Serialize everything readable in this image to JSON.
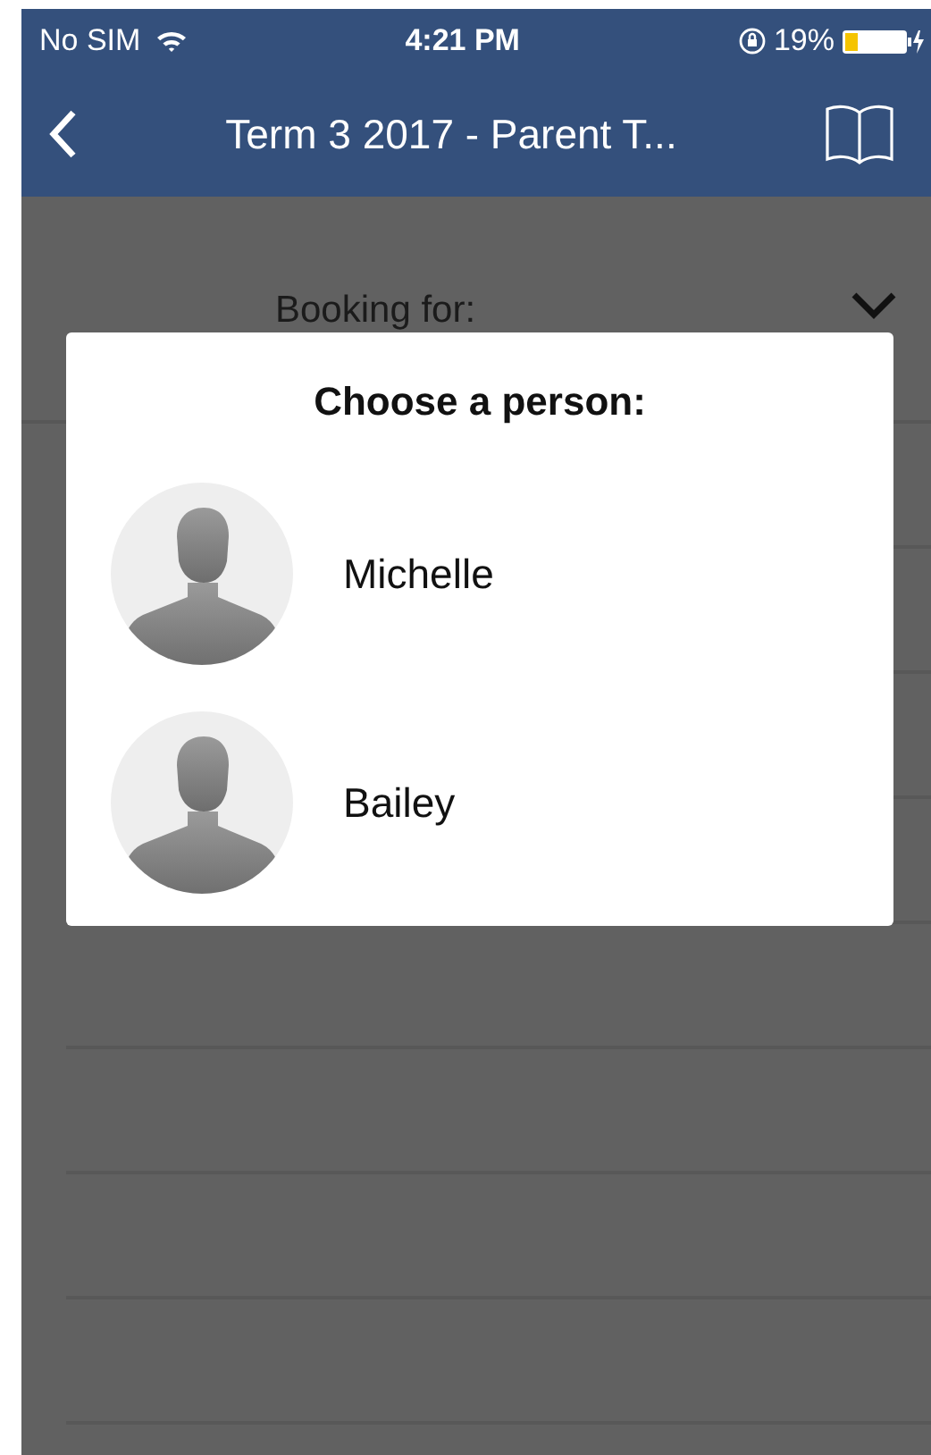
{
  "status_bar": {
    "carrier": "No SIM",
    "time": "4:21 PM",
    "battery": "19%"
  },
  "nav_bar": {
    "title": "Term 3 2017 - Parent T..."
  },
  "booking": {
    "label": "Booking for:"
  },
  "dialog": {
    "title": "Choose a person:",
    "people": [
      {
        "name": "Michelle"
      },
      {
        "name": "Bailey"
      }
    ]
  }
}
